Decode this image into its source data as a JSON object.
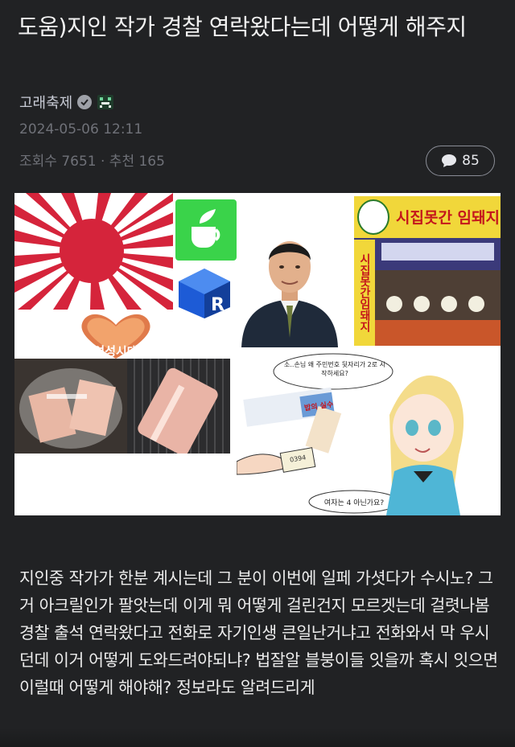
{
  "post": {
    "title": "도움)지인 작가 경찰 연락왔다는데 어떻게 해주지",
    "author": "고래축제",
    "date": "2024-05-06 12:11",
    "stats": "조회수 7651 · 추천 165",
    "comment_count": "85",
    "body": "지인중 작가가 한분 계시는데 그 분이 이번에 일페 가셧다가 수시노? 그거 아크릴인가  팔앗는데 이게 뭐 어떻게 걸린건지 모르겟는데 걸렷나봄 경찰 출석 연락왔다고 전화로 자기인생 큰일난거냐고 전화와서 막 우시던데 이거 어떻게 도와드려야되냐? 법잘알 블붕이들 잇을까 혹시 잇으면 이럴때 어떻게 해야해? 정보라도 알려드리게"
  },
  "image": {
    "heart_text": "여성시대",
    "sign_text": "시집못간 임돼지",
    "sign_vertical": "시집못간임돼지",
    "bubble_top": "소..손님 왜 주민번호 뒷자리가 2로 시작하세요?",
    "bubble_bottom": "여자는 4 아닌가요?",
    "phone_tail": "0394",
    "box_label": "밥의 실수"
  },
  "icons": {
    "verified": "verified-badge-icon",
    "game": "game-badge-icon",
    "comment": "comment-bubble-icon"
  },
  "colors": {
    "background": "#212224",
    "muted_text": "#6f7178",
    "author_text": "#c9ccd6"
  }
}
